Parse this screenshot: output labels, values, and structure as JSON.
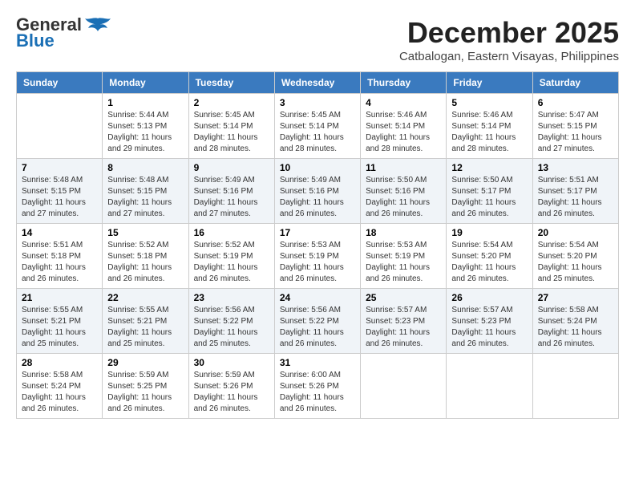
{
  "header": {
    "logo_line1": "General",
    "logo_line2": "Blue",
    "month": "December 2025",
    "location": "Catbalogan, Eastern Visayas, Philippines"
  },
  "weekdays": [
    "Sunday",
    "Monday",
    "Tuesday",
    "Wednesday",
    "Thursday",
    "Friday",
    "Saturday"
  ],
  "weeks": [
    [
      {
        "day": "",
        "info": ""
      },
      {
        "day": "1",
        "info": "Sunrise: 5:44 AM\nSunset: 5:13 PM\nDaylight: 11 hours\nand 29 minutes."
      },
      {
        "day": "2",
        "info": "Sunrise: 5:45 AM\nSunset: 5:14 PM\nDaylight: 11 hours\nand 28 minutes."
      },
      {
        "day": "3",
        "info": "Sunrise: 5:45 AM\nSunset: 5:14 PM\nDaylight: 11 hours\nand 28 minutes."
      },
      {
        "day": "4",
        "info": "Sunrise: 5:46 AM\nSunset: 5:14 PM\nDaylight: 11 hours\nand 28 minutes."
      },
      {
        "day": "5",
        "info": "Sunrise: 5:46 AM\nSunset: 5:14 PM\nDaylight: 11 hours\nand 28 minutes."
      },
      {
        "day": "6",
        "info": "Sunrise: 5:47 AM\nSunset: 5:15 PM\nDaylight: 11 hours\nand 27 minutes."
      }
    ],
    [
      {
        "day": "7",
        "info": "Sunrise: 5:48 AM\nSunset: 5:15 PM\nDaylight: 11 hours\nand 27 minutes."
      },
      {
        "day": "8",
        "info": "Sunrise: 5:48 AM\nSunset: 5:15 PM\nDaylight: 11 hours\nand 27 minutes."
      },
      {
        "day": "9",
        "info": "Sunrise: 5:49 AM\nSunset: 5:16 PM\nDaylight: 11 hours\nand 27 minutes."
      },
      {
        "day": "10",
        "info": "Sunrise: 5:49 AM\nSunset: 5:16 PM\nDaylight: 11 hours\nand 26 minutes."
      },
      {
        "day": "11",
        "info": "Sunrise: 5:50 AM\nSunset: 5:16 PM\nDaylight: 11 hours\nand 26 minutes."
      },
      {
        "day": "12",
        "info": "Sunrise: 5:50 AM\nSunset: 5:17 PM\nDaylight: 11 hours\nand 26 minutes."
      },
      {
        "day": "13",
        "info": "Sunrise: 5:51 AM\nSunset: 5:17 PM\nDaylight: 11 hours\nand 26 minutes."
      }
    ],
    [
      {
        "day": "14",
        "info": "Sunrise: 5:51 AM\nSunset: 5:18 PM\nDaylight: 11 hours\nand 26 minutes."
      },
      {
        "day": "15",
        "info": "Sunrise: 5:52 AM\nSunset: 5:18 PM\nDaylight: 11 hours\nand 26 minutes."
      },
      {
        "day": "16",
        "info": "Sunrise: 5:52 AM\nSunset: 5:19 PM\nDaylight: 11 hours\nand 26 minutes."
      },
      {
        "day": "17",
        "info": "Sunrise: 5:53 AM\nSunset: 5:19 PM\nDaylight: 11 hours\nand 26 minutes."
      },
      {
        "day": "18",
        "info": "Sunrise: 5:53 AM\nSunset: 5:19 PM\nDaylight: 11 hours\nand 26 minutes."
      },
      {
        "day": "19",
        "info": "Sunrise: 5:54 AM\nSunset: 5:20 PM\nDaylight: 11 hours\nand 26 minutes."
      },
      {
        "day": "20",
        "info": "Sunrise: 5:54 AM\nSunset: 5:20 PM\nDaylight: 11 hours\nand 25 minutes."
      }
    ],
    [
      {
        "day": "21",
        "info": "Sunrise: 5:55 AM\nSunset: 5:21 PM\nDaylight: 11 hours\nand 25 minutes."
      },
      {
        "day": "22",
        "info": "Sunrise: 5:55 AM\nSunset: 5:21 PM\nDaylight: 11 hours\nand 25 minutes."
      },
      {
        "day": "23",
        "info": "Sunrise: 5:56 AM\nSunset: 5:22 PM\nDaylight: 11 hours\nand 25 minutes."
      },
      {
        "day": "24",
        "info": "Sunrise: 5:56 AM\nSunset: 5:22 PM\nDaylight: 11 hours\nand 26 minutes."
      },
      {
        "day": "25",
        "info": "Sunrise: 5:57 AM\nSunset: 5:23 PM\nDaylight: 11 hours\nand 26 minutes."
      },
      {
        "day": "26",
        "info": "Sunrise: 5:57 AM\nSunset: 5:23 PM\nDaylight: 11 hours\nand 26 minutes."
      },
      {
        "day": "27",
        "info": "Sunrise: 5:58 AM\nSunset: 5:24 PM\nDaylight: 11 hours\nand 26 minutes."
      }
    ],
    [
      {
        "day": "28",
        "info": "Sunrise: 5:58 AM\nSunset: 5:24 PM\nDaylight: 11 hours\nand 26 minutes."
      },
      {
        "day": "29",
        "info": "Sunrise: 5:59 AM\nSunset: 5:25 PM\nDaylight: 11 hours\nand 26 minutes."
      },
      {
        "day": "30",
        "info": "Sunrise: 5:59 AM\nSunset: 5:26 PM\nDaylight: 11 hours\nand 26 minutes."
      },
      {
        "day": "31",
        "info": "Sunrise: 6:00 AM\nSunset: 5:26 PM\nDaylight: 11 hours\nand 26 minutes."
      },
      {
        "day": "",
        "info": ""
      },
      {
        "day": "",
        "info": ""
      },
      {
        "day": "",
        "info": ""
      }
    ]
  ]
}
